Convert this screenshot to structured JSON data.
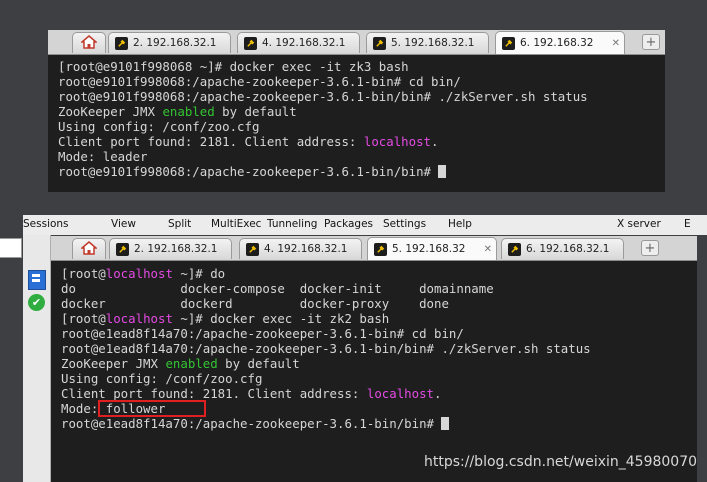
{
  "top_window": {
    "tabs": [
      {
        "label": "2. 192.168.32.1",
        "state": "normal"
      },
      {
        "label": "4. 192.168.32.1",
        "state": "normal"
      },
      {
        "label": "5. 192.168.32.1",
        "state": "normal"
      },
      {
        "label": "6. 192.168.32",
        "state": "active"
      }
    ],
    "lines": [
      [
        {
          "t": "[root@e9101f998068 ~]# docker exec -it zk3 bash"
        }
      ],
      [
        {
          "t": "root@e9101f998068:/apache-zookeeper-3.6.1-bin# cd bin/"
        }
      ],
      [
        {
          "t": "root@e9101f998068:/apache-zookeeper-3.6.1-bin/bin# ./zkServer.sh status"
        }
      ],
      [
        {
          "t": "ZooKeeper JMX "
        },
        {
          "t": "enabled",
          "c": "g"
        },
        {
          "t": " by default"
        }
      ],
      [
        {
          "t": "Using config: /conf/zoo.cfg"
        }
      ],
      [
        {
          "t": "Client port found: 2181. Client address: "
        },
        {
          "t": "localhost",
          "c": "m"
        },
        {
          "t": "."
        }
      ],
      [
        {
          "t": "Mode: leader"
        }
      ],
      [
        {
          "t": "root@e9101f998068:/apache-zookeeper-3.6.1-bin/bin# "
        }
      ]
    ]
  },
  "menubar": {
    "items": [
      "Sessions",
      "View",
      "Split",
      "MultiExec",
      "Tunneling",
      "Packages",
      "Settings",
      "Help",
      "X server",
      "E"
    ]
  },
  "bottom_window": {
    "tabs": [
      {
        "label": "2. 192.168.32.1",
        "state": "normal"
      },
      {
        "label": "4. 192.168.32.1",
        "state": "normal"
      },
      {
        "label": "5. 192.168.32",
        "state": "active"
      },
      {
        "label": "6. 192.168.32.1",
        "state": "normal"
      }
    ],
    "lines": [
      [
        {
          "t": "[root@"
        },
        {
          "t": "localhost",
          "c": "m"
        },
        {
          "t": " ~]# do"
        }
      ],
      [
        {
          "t": "do              docker-compose  docker-init     domainname"
        }
      ],
      [
        {
          "t": "docker          dockerd         docker-proxy    done"
        }
      ],
      [
        {
          "t": "[root@"
        },
        {
          "t": "localhost",
          "c": "m"
        },
        {
          "t": " ~]# docker exec -it zk2 bash"
        }
      ],
      [
        {
          "t": "root@e1ead8f14a70:/apache-zookeeper-3.6.1-bin# cd bin/"
        }
      ],
      [
        {
          "t": "root@e1ead8f14a70:/apache-zookeeper-3.6.1-bin/bin# ./zkServer.sh status"
        }
      ],
      [
        {
          "t": "ZooKeeper JMX "
        },
        {
          "t": "enabled",
          "c": "g"
        },
        {
          "t": " by default"
        }
      ],
      [
        {
          "t": "Using config: /conf/zoo.cfg"
        }
      ],
      [
        {
          "t": "Client port found: 2181. Client address: "
        },
        {
          "t": "localhost",
          "c": "m"
        },
        {
          "t": "."
        }
      ],
      [
        {
          "t": "Mode: follower"
        }
      ],
      [
        {
          "t": "root@e1ead8f14a70:/apache-zookeeper-3.6.1-bin/bin# "
        }
      ]
    ]
  },
  "watermark": "https://blog.csdn.net/weixin_45980070",
  "colors": {
    "enabled": "#34c434",
    "localhost": "#e34be3",
    "highlight_box": "#e02020"
  },
  "icons": {
    "home_tab": "home-icon",
    "session_tab": "wrench-icon",
    "new_tab": "plus-icon",
    "close_tab": "close-icon"
  }
}
